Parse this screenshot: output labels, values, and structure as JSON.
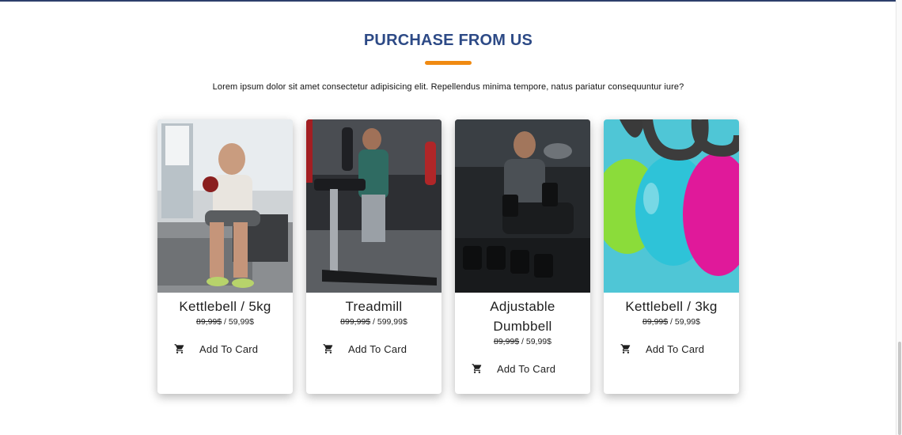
{
  "section": {
    "title": "PURCHASE FROM US",
    "subtitle": "Lorem ipsum dolor sit amet consectetur adipisicing elit. Repellendus minima tempore, natus pariatur consequuntur iure?"
  },
  "products": [
    {
      "name": "Kettlebell / 5kg",
      "old_price": "89,99$",
      "separator": " / ",
      "price": "59,99$",
      "button": "Add To Card",
      "image": "man-lifting-kettlebell-photo"
    },
    {
      "name": "Treadmill",
      "old_price": "899,99$",
      "separator": " / ",
      "price": "599,99$",
      "button": "Add To Card",
      "image": "man-on-treadmill-photo"
    },
    {
      "name": "Adjustable Dumbbell",
      "old_price": "89,99$",
      "separator": " / ",
      "price": "59,99$",
      "button": "Add To Card",
      "image": "man-with-dumbbells-photo"
    },
    {
      "name": "Kettlebell / 3kg",
      "old_price": "89,99$",
      "separator": " / ",
      "price": "59,99$",
      "button": "Add To Card",
      "image": "colorful-kettlebells-photo"
    }
  ],
  "colors": {
    "title": "#2d4a86",
    "accent": "#f08a12"
  },
  "icons": {
    "cart": "shopping-cart-icon"
  }
}
